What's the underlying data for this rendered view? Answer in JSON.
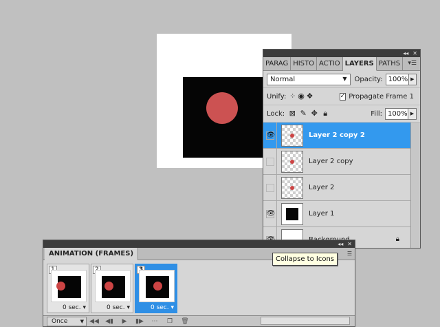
{
  "layers_panel": {
    "tabs": [
      "PARAG",
      "HISTO",
      "ACTIO",
      "LAYERS",
      "PATHS"
    ],
    "active_tab": "LAYERS",
    "blend_mode": "Normal",
    "opacity_label": "Opacity:",
    "opacity_value": "100%",
    "unify_label": "Unify:",
    "propagate_label": "Propagate Frame 1",
    "lock_label": "Lock:",
    "fill_label": "Fill:",
    "fill_value": "100%",
    "layers": [
      {
        "name": "Layer 2 copy 2",
        "visible": true,
        "selected": true
      },
      {
        "name": "Layer 2 copy",
        "visible": false,
        "selected": false
      },
      {
        "name": "Layer 2",
        "visible": false,
        "selected": false
      },
      {
        "name": "Layer 1",
        "visible": true,
        "selected": false
      },
      {
        "name": "Background",
        "visible": true,
        "selected": false,
        "locked": true
      }
    ]
  },
  "animation_panel": {
    "title": "ANIMATION (FRAMES)",
    "frames": [
      {
        "number": "1",
        "time": "0 sec.",
        "selected": false
      },
      {
        "number": "2",
        "time": "0 sec.",
        "selected": false
      },
      {
        "number": "3",
        "time": "0 sec.",
        "selected": true
      }
    ],
    "loop_option": "Once"
  },
  "tooltip": "Collapse to Icons",
  "colors": {
    "accent": "#3399ee",
    "dot": "#cc5252"
  }
}
